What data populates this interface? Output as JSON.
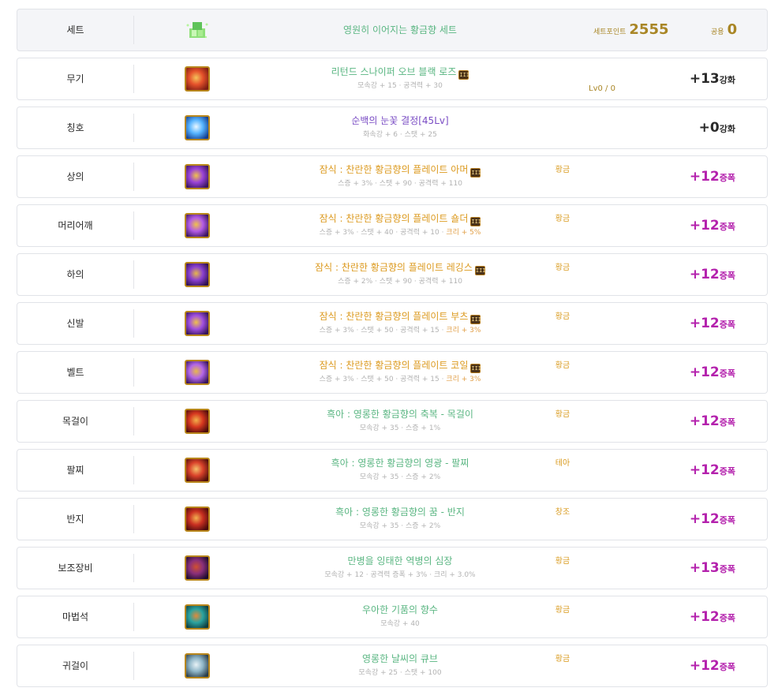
{
  "set": {
    "slot": "세트",
    "name": "영원히 이어지는 황금향 세트",
    "point_label": "세트포인트",
    "point_value": "2555",
    "common_label": "공용",
    "common_value": "0"
  },
  "rows": [
    {
      "slot": "무기",
      "name": "리턴드 스나이퍼 오브 블랙 로즈",
      "name_color": "green",
      "badge": "III",
      "stats": [
        "모속강 + 15",
        "공격력 + 30"
      ],
      "grade": "",
      "lv": "Lv0 / 0",
      "enh_num": "+13",
      "enh_label": "강화",
      "enh_type": "gain",
      "icon": "weapon-red"
    },
    {
      "slot": "칭호",
      "name": "순백의 눈꽃 결정[45Lv]",
      "name_color": "purple",
      "badge": "",
      "stats": [
        "화속강 + 6",
        "스탯 + 25"
      ],
      "grade": "",
      "lv": "",
      "enh_num": "+0",
      "enh_label": "강화",
      "enh_type": "gain",
      "icon": "title-snow"
    },
    {
      "slot": "상의",
      "name": "잠식 : 찬란한 황금향의 플레이트 아머",
      "name_color": "orange",
      "badge": "III",
      "stats": [
        "스증 + 3%",
        "스탯 + 90",
        "공격력 + 110"
      ],
      "grade": "황금",
      "lv": "",
      "enh_num": "+12",
      "enh_label": "증폭",
      "enh_type": "star",
      "icon": "armor-purple"
    },
    {
      "slot": "머리어깨",
      "name": "잠식 : 찬란한 황금향의 플레이트 숄더",
      "name_color": "orange",
      "badge": "III",
      "stats": [
        "스증 + 3%",
        "스탯 + 40",
        "공격력 + 10",
        "크리 + 5%"
      ],
      "grade": "황금",
      "lv": "",
      "enh_num": "+12",
      "enh_label": "증폭",
      "enh_type": "star",
      "icon": "shoulder-purple"
    },
    {
      "slot": "하의",
      "name": "잠식 : 찬란한 황금향의 플레이트 레깅스",
      "name_color": "orange",
      "badge": "III",
      "stats": [
        "스증 + 2%",
        "스탯 + 90",
        "공격력 + 110"
      ],
      "grade": "황금",
      "lv": "",
      "enh_num": "+12",
      "enh_label": "증폭",
      "enh_type": "star",
      "icon": "legs-purple"
    },
    {
      "slot": "신발",
      "name": "잠식 : 찬란한 황금향의 플레이트 부츠",
      "name_color": "orange",
      "badge": "III",
      "stats": [
        "스증 + 3%",
        "스탯 + 50",
        "공격력 + 15",
        "크리 + 3%"
      ],
      "grade": "황금",
      "lv": "",
      "enh_num": "+12",
      "enh_label": "증폭",
      "enh_type": "star",
      "icon": "boots-purple"
    },
    {
      "slot": "벨트",
      "name": "잠식 : 찬란한 황금향의 플레이트 코일",
      "name_color": "orange",
      "badge": "III",
      "stats": [
        "스증 + 3%",
        "스탯 + 50",
        "공격력 + 15",
        "크리 + 3%"
      ],
      "grade": "황금",
      "lv": "",
      "enh_num": "+12",
      "enh_label": "증폭",
      "enh_type": "star",
      "icon": "belt-purple"
    },
    {
      "slot": "목걸이",
      "name": "흑아 : 영롱한 황금향의 축복 - 목걸이",
      "name_color": "green",
      "badge": "",
      "stats": [
        "모속강 + 35",
        "스증 + 1%"
      ],
      "grade": "황금",
      "lv": "",
      "enh_num": "+12",
      "enh_label": "증폭",
      "enh_type": "star",
      "icon": "necklace-red"
    },
    {
      "slot": "팔찌",
      "name": "흑아 : 영롱한 황금향의 영광 - 팔찌",
      "name_color": "green",
      "badge": "",
      "stats": [
        "모속강 + 35",
        "스증 + 2%"
      ],
      "grade": "테아",
      "lv": "",
      "enh_num": "+12",
      "enh_label": "증폭",
      "enh_type": "star",
      "icon": "bracelet-red"
    },
    {
      "slot": "반지",
      "name": "흑아 : 영롱한 황금향의 꿈 - 반지",
      "name_color": "green",
      "badge": "",
      "stats": [
        "모속강 + 35",
        "스증 + 2%"
      ],
      "grade": "창조",
      "lv": "",
      "enh_num": "+12",
      "enh_label": "증폭",
      "enh_type": "star",
      "icon": "ring-red"
    },
    {
      "slot": "보조장비",
      "name": "만병을 잉태한 역병의 심장",
      "name_color": "green",
      "badge": "",
      "stats": [
        "모속강 + 12",
        "공격력 증폭 + 3%",
        "크리 + 3.0%"
      ],
      "grade": "황금",
      "lv": "",
      "enh_num": "+13",
      "enh_label": "증폭",
      "enh_type": "star",
      "icon": "heart-dark"
    },
    {
      "slot": "마법석",
      "name": "우아한 기품의 향수",
      "name_color": "green",
      "badge": "",
      "stats": [
        "모속강 + 40"
      ],
      "grade": "황금",
      "lv": "",
      "enh_num": "+12",
      "enh_label": "증폭",
      "enh_type": "star",
      "icon": "magicstone-teal"
    },
    {
      "slot": "귀걸이",
      "name": "영롱한 날씨의 큐브",
      "name_color": "green",
      "badge": "",
      "stats": [
        "모속강 + 25",
        "스탯 + 100"
      ],
      "grade": "황금",
      "lv": "",
      "enh_num": "+12",
      "enh_label": "증폭",
      "enh_type": "star",
      "icon": "earring-cube"
    }
  ]
}
